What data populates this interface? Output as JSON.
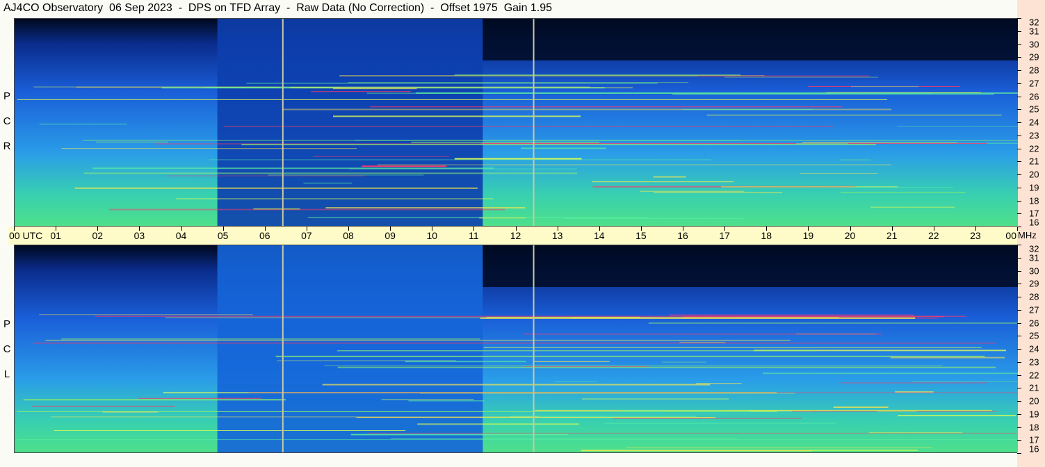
{
  "header": {
    "title": "AJ4CO Observatory  06 Sep 2023  -  DPS on TFD Array  -  Raw Data (No Correction)  -  Offset 1975  Gain 1.95"
  },
  "panels": {
    "top_label": [
      "R",
      "C",
      "P"
    ],
    "bottom_label": [
      "L",
      "C",
      "P"
    ]
  },
  "chart_data": {
    "type": "heatmap",
    "x_axis": {
      "unit": "UTC",
      "tick_labels": [
        "00",
        "01",
        "02",
        "03",
        "04",
        "05",
        "06",
        "07",
        "08",
        "09",
        "10",
        "11",
        "12",
        "13",
        "14",
        "15",
        "16",
        "17",
        "18",
        "19",
        "20",
        "21",
        "22",
        "23",
        "00"
      ],
      "range": [
        0,
        24
      ]
    },
    "y_axis": {
      "unit": "MHz",
      "tick_labels": [
        "32",
        "31",
        "30",
        "29",
        "28",
        "27",
        "26",
        "25",
        "24",
        "23",
        "22",
        "21",
        "20",
        "19",
        "18",
        "17",
        "16"
      ],
      "range": [
        16,
        32
      ]
    },
    "series": [
      {
        "name": "RCP"
      },
      {
        "name": "LCP"
      }
    ],
    "markers_utc": [
      6.4,
      12.4
    ],
    "colors": {
      "low": "#000a2a",
      "mid": "#1060e0",
      "high": "#40e0a0",
      "peak": "#ff3060"
    }
  }
}
